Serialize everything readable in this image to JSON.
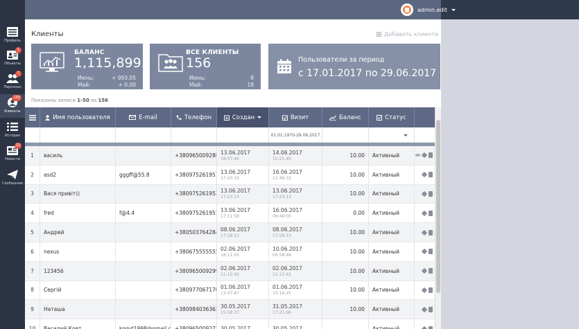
{
  "header": {
    "user_name": "admin.edit"
  },
  "sidebar": {
    "items": [
      {
        "label": "Профиль",
        "icon": "profile-icon",
        "badge": ""
      },
      {
        "label": "Объекты",
        "icon": "objects-icon",
        "badge": "1"
      },
      {
        "label": "Персонал",
        "icon": "staff-icon",
        "badge": "7"
      },
      {
        "label": "Клиенты",
        "icon": "clients-icon",
        "badge": "156"
      },
      {
        "label": "История",
        "icon": "history-icon",
        "badge": ""
      },
      {
        "label": "Новости",
        "icon": "news-icon",
        "badge": "13"
      },
      {
        "label": "Сообщения",
        "icon": "messages-icon",
        "badge": ""
      }
    ]
  },
  "page": {
    "title": "Клиенты",
    "add_client": "Добавить клиента",
    "records_info_prefix": "Показаны записи ",
    "records_range": "1-50",
    "records_info_mid": " из ",
    "records_total": "156"
  },
  "cards": {
    "balance": {
      "title": "БАЛАНС",
      "value": "1,115,899.98",
      "row1_label": "Июнь:",
      "row1_value": "+ 993.05",
      "row2_label": "Май:",
      "row2_value": "+ 0.00"
    },
    "clients": {
      "title": "ВСЕ КЛИЕНТЫ",
      "value": "156",
      "row1_label": "Июнь:",
      "row1_value": "8",
      "row2_label": "Май:",
      "row2_value": "18"
    },
    "period": {
      "title": "Пользователи за период",
      "value": "с 17.01.2017 по 29.06.2017"
    }
  },
  "table": {
    "columns": {
      "username": "Имя пользователя",
      "email": "E-mail",
      "phone": "Телефон",
      "created": "Создан",
      "visit": "Визит",
      "balance": "Баланс",
      "status": "Статус"
    },
    "visit_filter": "01.01.1970-29.06.2017",
    "rows": [
      {
        "n": "1",
        "name": "василь",
        "email": "",
        "phone": "+380965009288",
        "c_date": "13.06.2017",
        "c_time": "18:07:40",
        "v_date": "14.06.2017",
        "v_time": "10:21:45",
        "balance": "10.00",
        "status": "Активный"
      },
      {
        "n": "2",
        "name": "asd2",
        "email": "gggff@55.8",
        "phone": "+380975261953",
        "c_date": "13.06.2017",
        "c_time": "17:43:10",
        "v_date": "16.06.2017",
        "v_time": "11:46:33",
        "balance": "10.00",
        "status": "Активный"
      },
      {
        "n": "3",
        "name": "Вася привіт))",
        "email": "",
        "phone": "+380975261952",
        "c_date": "13.06.2017",
        "c_time": "17:23:13",
        "v_date": "13.06.2017",
        "v_time": "17:23:13",
        "balance": "10.00",
        "status": "Активный"
      },
      {
        "n": "4",
        "name": "fred",
        "email": "f@4.4",
        "phone": "+380975261951",
        "c_date": "13.06.2017",
        "c_time": "17:11:58",
        "v_date": "16.06.2017",
        "v_time": "09:49:05",
        "balance": "0.00",
        "status": "Активный"
      },
      {
        "n": "5",
        "name": "Андрей",
        "email": "",
        "phone": "+380503764284",
        "c_date": "08.06.2017",
        "c_time": "17:58:13",
        "v_date": "08.06.2017",
        "v_time": "17:58:13",
        "balance": "10.00",
        "status": "Активный"
      },
      {
        "n": "6",
        "name": "nexus",
        "email": "",
        "phone": "+380675555555",
        "c_date": "02.06.2017",
        "c_time": "18:11:05",
        "v_date": "10.06.2017",
        "v_time": "06:58:48",
        "balance": "10.00",
        "status": "Активный"
      },
      {
        "n": "7",
        "name": "123456",
        "email": "",
        "phone": "+380965009299",
        "c_date": "02.06.2017",
        "c_time": "11:12:42",
        "v_date": "02.06.2017",
        "v_time": "11:12:42",
        "balance": "10.00",
        "status": "Активный"
      },
      {
        "n": "8",
        "name": "Сергій",
        "email": "",
        "phone": "+380977067170",
        "c_date": "01.06.2017",
        "c_time": "13:47:47",
        "v_date": "01.06.2017",
        "v_time": "15:16:25",
        "balance": "10.00",
        "status": "Активный"
      },
      {
        "n": "9",
        "name": "Наташа",
        "email": "",
        "phone": "+380984036362",
        "c_date": "30.05.2017",
        "c_time": "15:58:37",
        "v_date": "31.05.2017",
        "v_time": "17:21:06",
        "balance": "10.00",
        "status": "Активный"
      },
      {
        "n": "10",
        "name": "Василий Ковт",
        "email": "kogvt1998@gmail.c",
        "phone": "+380965009277",
        "c_date": "30.05.2017",
        "c_time": "",
        "v_date": "30.05.2017",
        "v_time": "",
        "balance": "",
        "status": "Активный"
      }
    ]
  },
  "colors": {
    "sidebar": "#2c3444",
    "header": "#5e6985",
    "card": "#7c879f",
    "badge": "#e2564b"
  }
}
